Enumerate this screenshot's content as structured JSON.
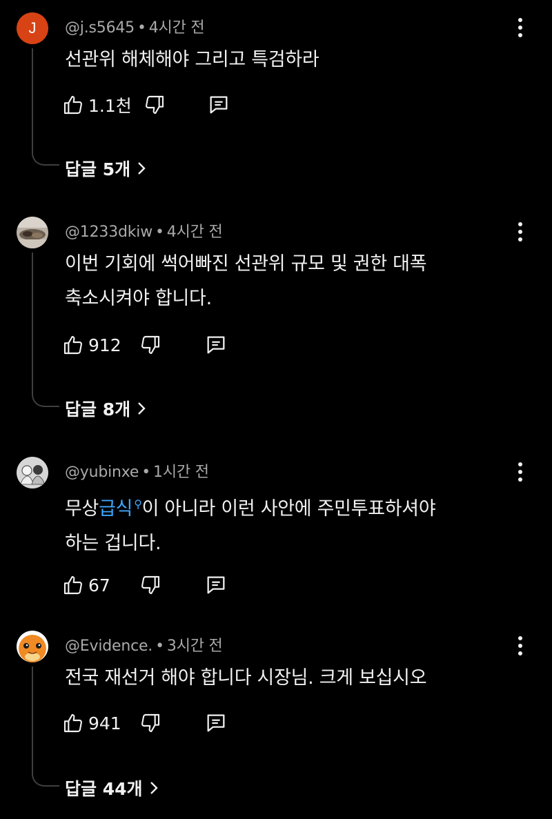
{
  "comments": [
    {
      "author": "@j.s5645",
      "time": "4시간 전",
      "avatar_letter": "J",
      "text_lines": [
        "선관위 해체해야 그리고 특검하라"
      ],
      "likes": "1.1천",
      "replies": "답글 5개"
    },
    {
      "author": "@1233dkiw",
      "time": "4시간 전",
      "text_lines": [
        "이번 기회에 썩어빠진 선관위 규모 및 권한 대폭",
        "축소시켜야 합니다."
      ],
      "likes": "912",
      "replies": "답글 8개"
    },
    {
      "author": "@yubinxe",
      "time": "1시간 전",
      "text_pre": "무상",
      "text_link": "급식",
      "text_post": "이 아니라 이런 사안에 주민투표하셔야",
      "text_line2": "하는 겁니다.",
      "likes": "67"
    },
    {
      "author": "@Evidence.",
      "time": "3시간 전",
      "text_lines": [
        "전국 재선거 해야 합니다 시장님. 크게 보십시오"
      ],
      "likes": "941",
      "replies": "답글 44개"
    }
  ],
  "separator": "•",
  "icons": {
    "like": "thumb-up-icon",
    "dislike": "thumb-down-icon",
    "reply": "reply-comment-icon",
    "more": "more-vertical-icon",
    "chevron": "chevron-right-icon",
    "search": "search-icon"
  },
  "colors": {
    "background": "#000000",
    "text": "#f1f1f1",
    "meta": "#aaaaaa",
    "link": "#3ea6ff",
    "avatar_j": "#d84315"
  }
}
